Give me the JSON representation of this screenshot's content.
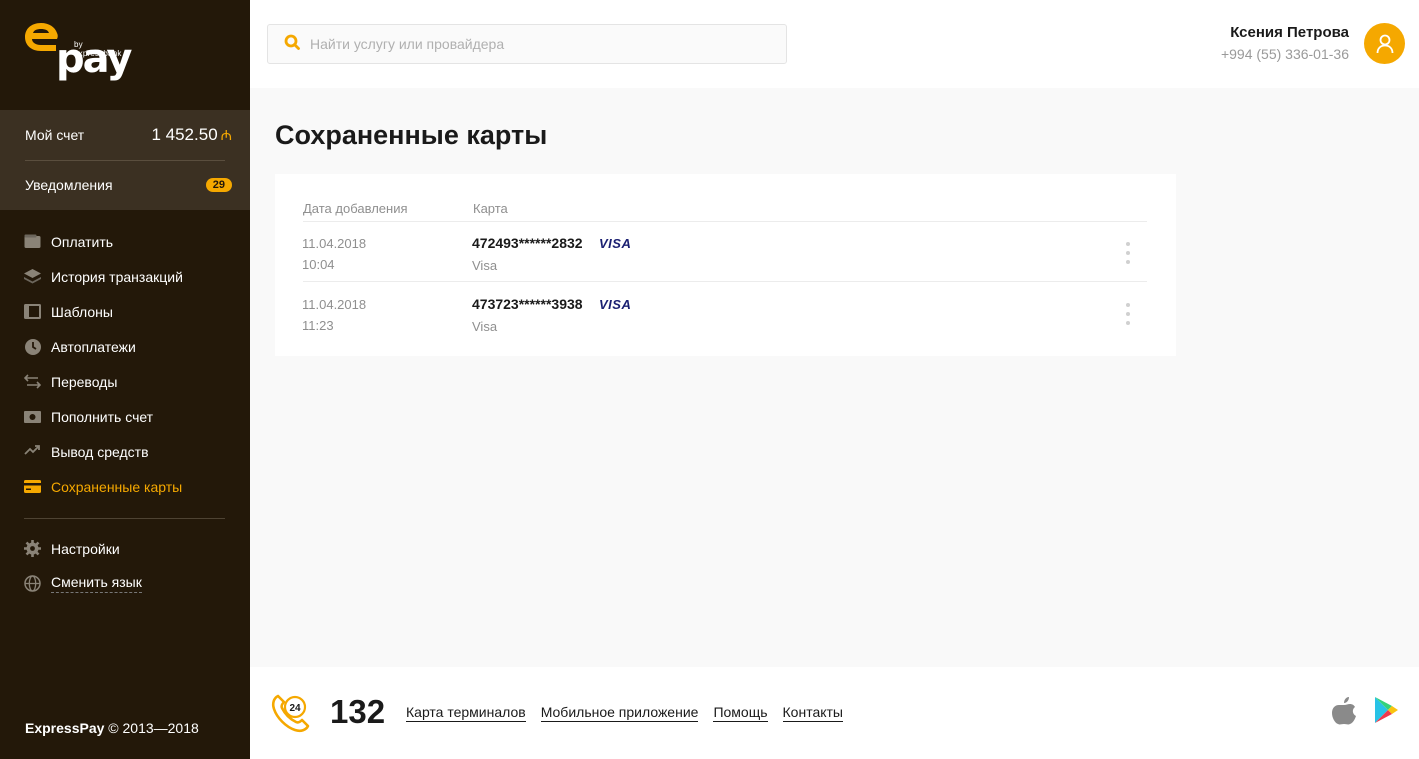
{
  "brand": {
    "logo_by": "by expressbank",
    "logo_pay": "pay",
    "accent": "#f5a800",
    "sidebar_bg": "#231809"
  },
  "account": {
    "label": "Мой счет",
    "balance": "1 452.50",
    "currency_icon": "manat-icon",
    "notifications_label": "Уведомления",
    "notifications_count": "29"
  },
  "nav": {
    "items": [
      {
        "label": "Оплатить",
        "icon": "wallet-icon"
      },
      {
        "label": "История транзакций",
        "icon": "layers-icon"
      },
      {
        "label": "Шаблоны",
        "icon": "template-icon"
      },
      {
        "label": "Автоплатежи",
        "icon": "clock-icon"
      },
      {
        "label": "Переводы",
        "icon": "transfer-icon"
      },
      {
        "label": "Пополнить счет",
        "icon": "top-up-icon"
      },
      {
        "label": "Вывод средств",
        "icon": "withdraw-icon"
      },
      {
        "label": "Сохраненные карты",
        "icon": "card-icon",
        "active": true
      }
    ],
    "settings_label": "Настройки",
    "language_label": "Сменить язык"
  },
  "copyright": {
    "brand": "ExpressPay",
    "text": " © 2013—2018"
  },
  "header": {
    "search_placeholder": "Найти услугу или провайдера",
    "user_name": "Ксения Петрова",
    "user_phone": "+994 (55) 336-01-36"
  },
  "page": {
    "title": "Сохраненные карты",
    "columns": {
      "date": "Дата добавления",
      "card": "Карта"
    },
    "cards": [
      {
        "date": "11.04.2018",
        "time": "10:04",
        "number": "472493******2832",
        "brand": "VISA",
        "type": "Visa"
      },
      {
        "date": "11.04.2018",
        "time": "11:23",
        "number": "473723******3938",
        "brand": "VISA",
        "type": "Visa"
      }
    ]
  },
  "footer": {
    "phone_badge": "24",
    "phone": "132",
    "links": [
      "Карта терминалов",
      "Мобильное приложение",
      "Помощь",
      "Контакты"
    ]
  }
}
